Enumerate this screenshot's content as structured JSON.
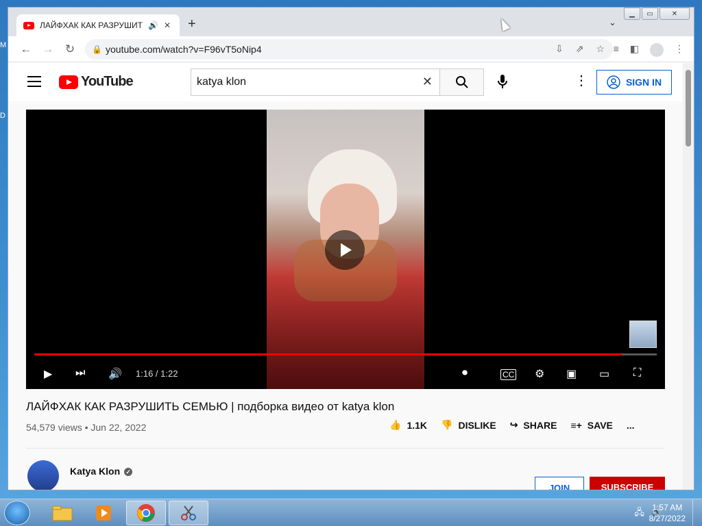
{
  "desktop": {
    "letters": [
      "M",
      "D"
    ]
  },
  "browser": {
    "tab_title": "ЛАЙФХАК КАК РАЗРУШИТЬ",
    "tab_audio_icon": "speaker-icon",
    "tab_close": "✕",
    "new_tab": "+",
    "url": "youtube.com/watch?v=F96vT5oNip4"
  },
  "youtube": {
    "logo_text": "YouTube",
    "search_value": "katya klon",
    "signin_label": "SIGN IN"
  },
  "player": {
    "progress_fraction": 0.944,
    "time": "1:16 / 1:22"
  },
  "video": {
    "title": "ЛАЙФХАК КАК РАЗРУШИТЬ СЕМЬЮ | подборка видео от katya klon",
    "meta": "54,579 views • Jun 22, 2022",
    "likes": "1.1K",
    "dislike_label": "DISLIKE",
    "share_label": "SHARE",
    "save_label": "SAVE",
    "more": "..."
  },
  "channel": {
    "name": "Katya Klon",
    "join_label": "JOIN",
    "subscribe_label": "SUBSCRIBE"
  },
  "taskbar": {
    "time": "1:57 AM",
    "date": "8/27/2022"
  }
}
